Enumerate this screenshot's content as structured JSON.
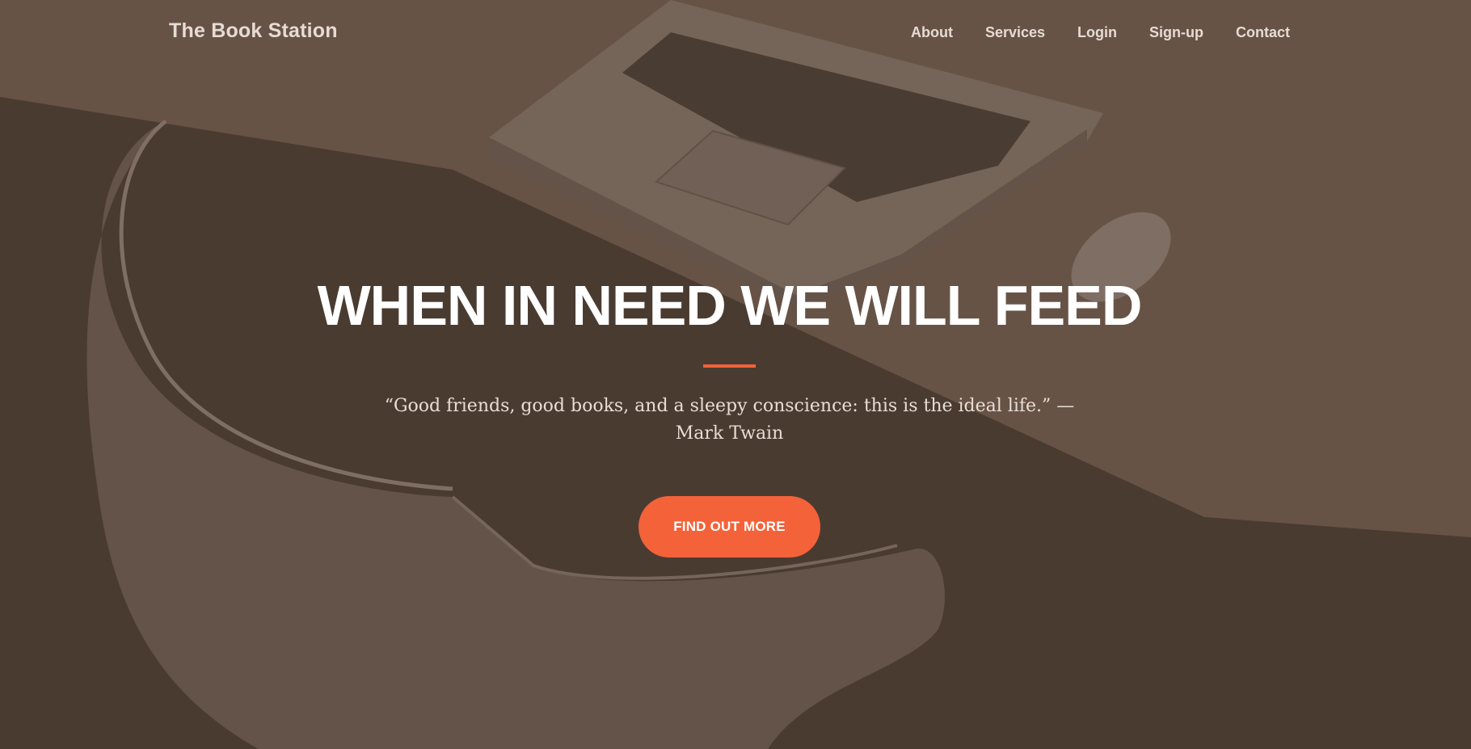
{
  "nav": {
    "brand": "The Book Station",
    "links": [
      "About",
      "Services",
      "Login",
      "Sign-up",
      "Contact"
    ]
  },
  "hero": {
    "headline": "WHEN IN NEED WE WILL FEED",
    "quote": "“Good friends, good books, and a sleepy conscience: this is the ideal life.” — Mark Twain",
    "cta_label": "FIND OUT MORE"
  },
  "colors": {
    "accent": "#f4623a",
    "background": "#4f3f35",
    "text_light": "#e6dcd3"
  }
}
